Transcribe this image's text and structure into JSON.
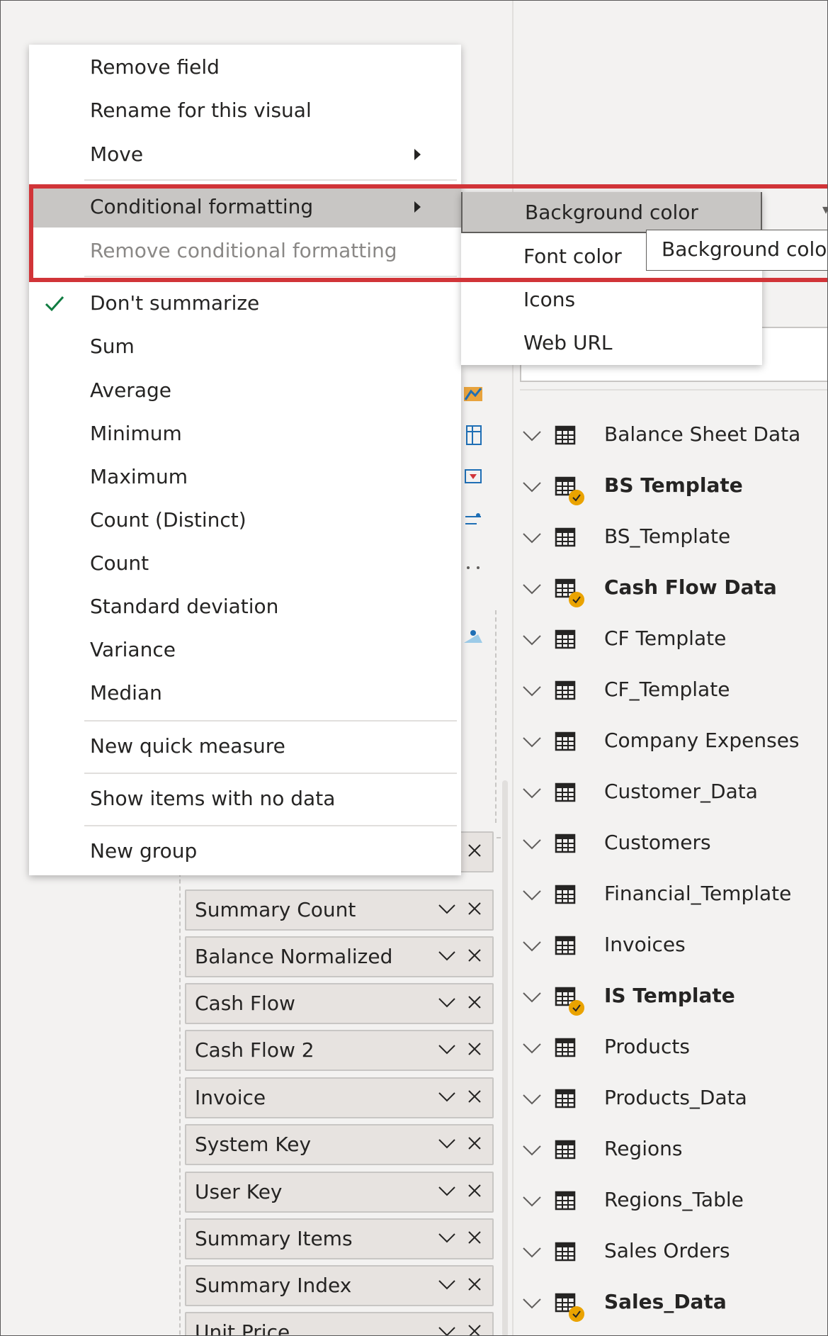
{
  "context_menu": {
    "items": [
      {
        "label": "Remove field"
      },
      {
        "label": "Rename for this visual"
      },
      {
        "label": "Move"
      },
      {
        "label": "Conditional formatting"
      },
      {
        "label": "Remove conditional formatting"
      },
      {
        "label": "Don't summarize"
      },
      {
        "label": "Sum"
      },
      {
        "label": "Average"
      },
      {
        "label": "Minimum"
      },
      {
        "label": "Maximum"
      },
      {
        "label": "Count (Distinct)"
      },
      {
        "label": "Count"
      },
      {
        "label": "Standard deviation"
      },
      {
        "label": "Variance"
      },
      {
        "label": "Median"
      },
      {
        "label": "New quick measure"
      },
      {
        "label": "Show items with no data"
      },
      {
        "label": "New group"
      }
    ]
  },
  "submenu": {
    "items": [
      {
        "label": "Background color"
      },
      {
        "label": "Font color"
      },
      {
        "label": "Icons"
      },
      {
        "label": "Web URL"
      }
    ]
  },
  "tooltip": {
    "text": "Background colo"
  },
  "values_well": {
    "fields": [
      {
        "label": "Summary Count"
      },
      {
        "label": "Balance Normalized"
      },
      {
        "label": "Cash Flow"
      },
      {
        "label": "Cash Flow 2"
      },
      {
        "label": "Invoice"
      },
      {
        "label": "System Key"
      },
      {
        "label": "User Key"
      },
      {
        "label": "Summary Items"
      },
      {
        "label": "Summary Index"
      },
      {
        "label": "Unit Price"
      }
    ]
  },
  "fields_pane": {
    "tables": [
      {
        "name": "Balance Sheet Data",
        "bold": false
      },
      {
        "name": "BS Template",
        "bold": true
      },
      {
        "name": "BS_Template",
        "bold": false
      },
      {
        "name": "Cash Flow Data",
        "bold": true
      },
      {
        "name": "CF Template",
        "bold": false
      },
      {
        "name": "CF_Template",
        "bold": false
      },
      {
        "name": "Company Expenses",
        "bold": false
      },
      {
        "name": "Customer_Data",
        "bold": false
      },
      {
        "name": "Customers",
        "bold": false
      },
      {
        "name": "Financial_Template",
        "bold": false
      },
      {
        "name": "Invoices",
        "bold": false
      },
      {
        "name": "IS Template",
        "bold": true
      },
      {
        "name": "Products",
        "bold": false
      },
      {
        "name": "Products_Data",
        "bold": false
      },
      {
        "name": "Regions",
        "bold": false
      },
      {
        "name": "Regions_Table",
        "bold": false
      },
      {
        "name": "Sales Orders",
        "bold": false
      },
      {
        "name": "Sales_Data",
        "bold": true
      }
    ]
  },
  "colors": {
    "highlight": "#c8c6c4",
    "annotation_red": "#d13438",
    "checkmark": "#107c41",
    "badge": "#eaa300"
  }
}
